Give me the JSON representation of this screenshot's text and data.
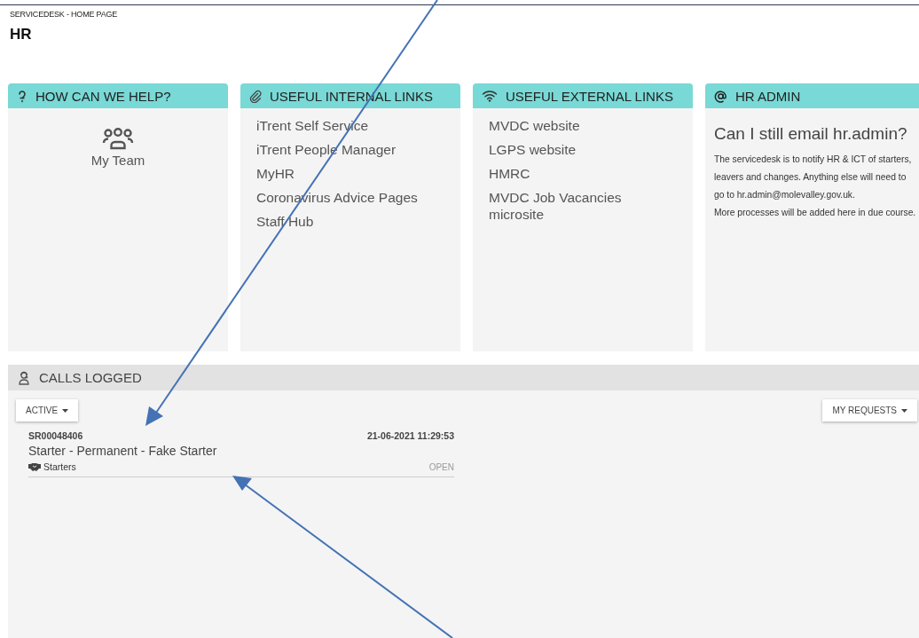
{
  "breadcrumb": "SERVICEDESK - HOME PAGE",
  "title": "HR",
  "cards": [
    {
      "kind": "tiles",
      "title": "HOW CAN WE HELP?",
      "tiles": [
        {
          "label": "My Team"
        }
      ]
    },
    {
      "kind": "links",
      "title": "USEFUL INTERNAL LINKS",
      "links": [
        "iTrent Self Service",
        "iTrent People Manager",
        "MyHR",
        "Coronavirus Advice Pages",
        "Staff Hub"
      ]
    },
    {
      "kind": "links",
      "title": "USEFUL EXTERNAL LINKS",
      "links": [
        "MVDC website",
        "LGPS website",
        "HMRC",
        "MVDC Job Vacancies microsite"
      ]
    },
    {
      "kind": "text",
      "title": "HR ADMIN",
      "heading": "Can I still email hr.admin?",
      "paragraphs": [
        "The servicedesk is to notify HR & ICT of starters, leavers and changes. Anything else will need to go to hr.admin@molevalley.gov.uk.",
        "More processes will be added here in due course."
      ]
    }
  ],
  "calls": {
    "title": "CALLS LOGGED",
    "filter": "ACTIVE",
    "scope": "MY REQUESTS",
    "items": [
      {
        "id": "SR00048406",
        "date": "21-06-2021 11:29:53",
        "subject": "Starter - Permanent - Fake Starter",
        "category": "Starters",
        "status": "OPEN"
      }
    ]
  }
}
